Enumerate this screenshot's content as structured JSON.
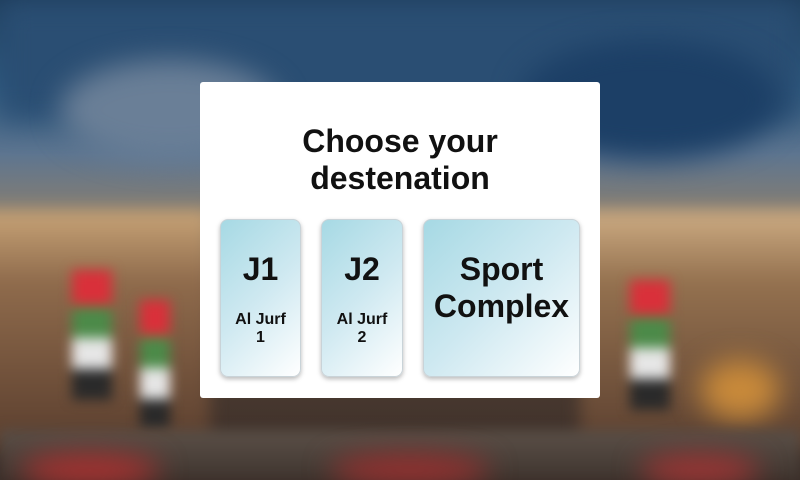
{
  "dialog": {
    "title_line1": "Choose your",
    "title_line2": "destenation"
  },
  "destinations": [
    {
      "code": "J1",
      "name_line1": "Al Jurf",
      "name_line2": "1"
    },
    {
      "code": "J2",
      "name_line1": "Al Jurf",
      "name_line2": "2"
    },
    {
      "label_line1": "Sport",
      "label_line2": "Complex"
    }
  ],
  "colors": {
    "card_gradient_start": "#a6d9e4",
    "card_gradient_end": "#ffffff",
    "modal_background": "#ffffff"
  }
}
